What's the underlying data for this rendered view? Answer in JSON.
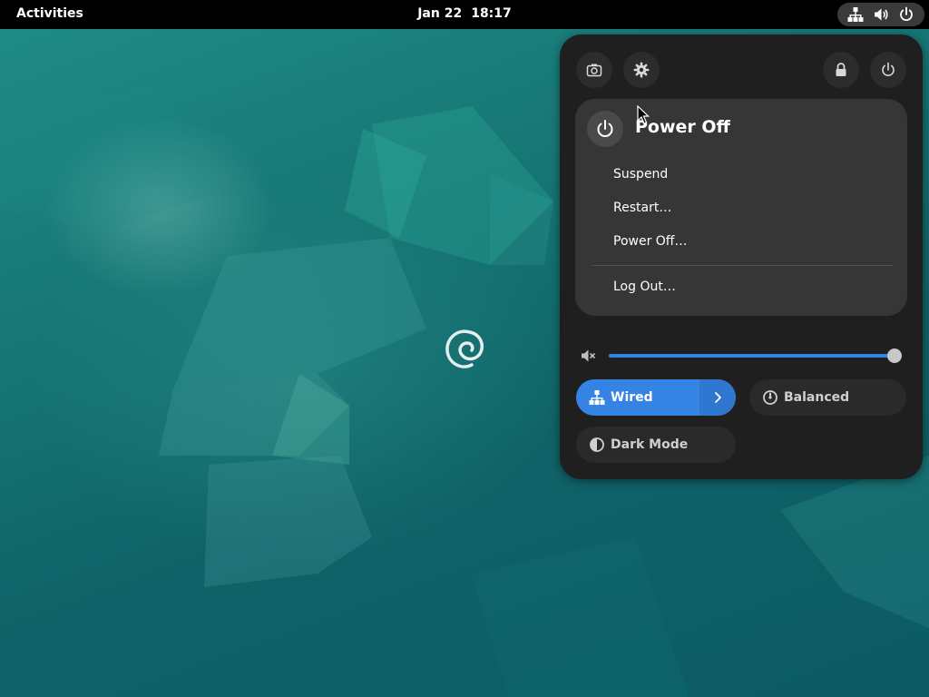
{
  "topbar": {
    "activities_label": "Activities",
    "date": "Jan 22",
    "time": "18:17",
    "status_icons": [
      "network-wired-icon",
      "volume-icon",
      "power-icon"
    ]
  },
  "quick_settings": {
    "top_buttons": [
      "screenshot-icon",
      "settings-icon",
      "lock-icon",
      "power-icon"
    ],
    "power_menu": {
      "title": "Power Off",
      "items": [
        "Suspend",
        "Restart…",
        "Power Off…"
      ],
      "logout_label": "Log Out…"
    },
    "volume": {
      "muted_icon": "audio-muted-icon",
      "level": 1.0
    },
    "toggles": {
      "wired_label": "Wired",
      "wired_active": true,
      "balanced_label": "Balanced",
      "dark_mode_label": "Dark Mode"
    }
  },
  "colors": {
    "accent": "#3584e4",
    "menu_bg": "#1f1f1f",
    "submenu_bg": "#363636",
    "topbar_bg": "#000000"
  }
}
